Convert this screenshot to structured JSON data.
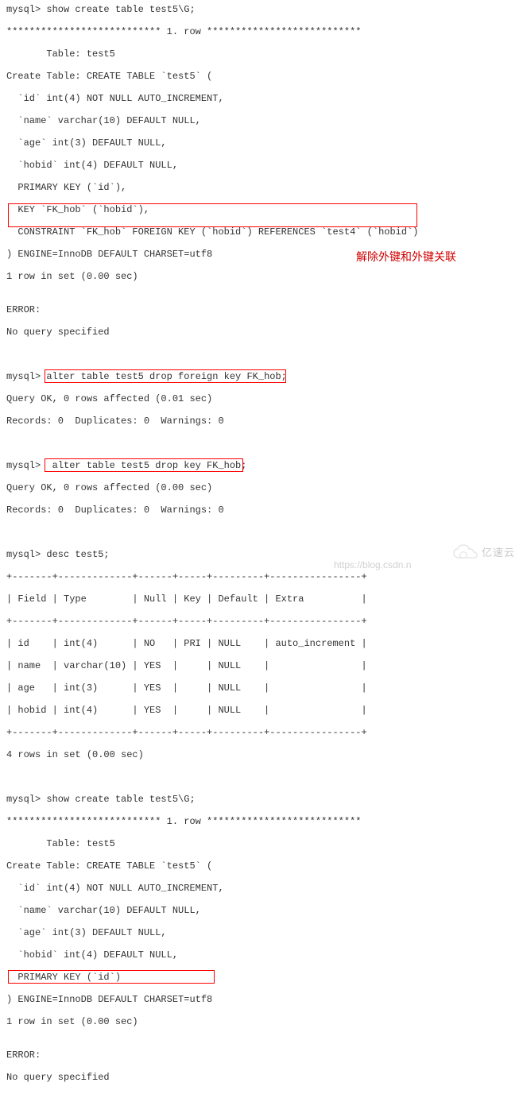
{
  "block1": {
    "l0": "mysql> show create table test5\\G;",
    "l1": "*************************** 1. row ***************************",
    "l2": "       Table: test5",
    "l3": "Create Table: CREATE TABLE `test5` (",
    "l4": "  `id` int(4) NOT NULL AUTO_INCREMENT,",
    "l5": "  `name` varchar(10) DEFAULT NULL,",
    "l6": "  `age` int(3) DEFAULT NULL,",
    "l7": "  `hobid` int(4) DEFAULT NULL,",
    "l8": "  PRIMARY KEY (`id`),",
    "l9": "  KEY `FK_hob` (`hobid`),",
    "l10": "  CONSTRAINT `FK_hob` FOREIGN KEY (`hobid`) REFERENCES `test4` (`hobid`)",
    "l11": ") ENGINE=InnoDB DEFAULT CHARSET=utf8",
    "l12": "1 row in set (0.00 sec)",
    "l13": "",
    "l14": "ERROR:",
    "l15": "No query specified"
  },
  "cmd1": {
    "prompt": "mysql> ",
    "sql": "alter table test5 drop foreign key FK_hob;",
    "res1": "Query OK, 0 rows affected (0.01 sec)",
    "res2": "Records: 0  Duplicates: 0  Warnings: 0"
  },
  "cmd2": {
    "prompt": "mysql> ",
    "sql": " alter table test5 drop key FK_hob;",
    "res1": "Query OK, 0 rows affected (0.00 sec)",
    "res2": "Records: 0  Duplicates: 0  Warnings: 0"
  },
  "annotation": "解除外键和外键关联",
  "desc": {
    "l0": "mysql> desc test5;",
    "l1": "+-------+-------------+------+-----+---------+----------------+",
    "l2": "| Field | Type        | Null | Key | Default | Extra          |",
    "l3": "+-------+-------------+------+-----+---------+----------------+",
    "l4": "| id    | int(4)      | NO   | PRI | NULL    | auto_increment |",
    "l5": "| name  | varchar(10) | YES  |     | NULL    |                |",
    "l6": "| age   | int(3)      | YES  |     | NULL    |                |",
    "l7": "| hobid | int(4)      | YES  |     | NULL    |                |",
    "l8": "+-------+-------------+------+-----+---------+----------------+",
    "l9": "4 rows in set (0.00 sec)"
  },
  "block2": {
    "l0": "mysql> show create table test5\\G;",
    "l1": "*************************** 1. row ***************************",
    "l2": "       Table: test5",
    "l3": "Create Table: CREATE TABLE `test5` (",
    "l4": "  `id` int(4) NOT NULL AUTO_INCREMENT,",
    "l5": "  `name` varchar(10) DEFAULT NULL,",
    "l6": "  `age` int(3) DEFAULT NULL,",
    "l7": "  `hobid` int(4) DEFAULT NULL,",
    "l8": "  PRIMARY KEY (`id`)",
    "l9": ") ENGINE=InnoDB DEFAULT CHARSET=utf8",
    "l10": "1 row in set (0.00 sec)",
    "l11": "",
    "l12": "ERROR:",
    "l13": "No query specified"
  },
  "watermark_url": "https://blog.csdn.n",
  "watermark_brand": "亿速云"
}
